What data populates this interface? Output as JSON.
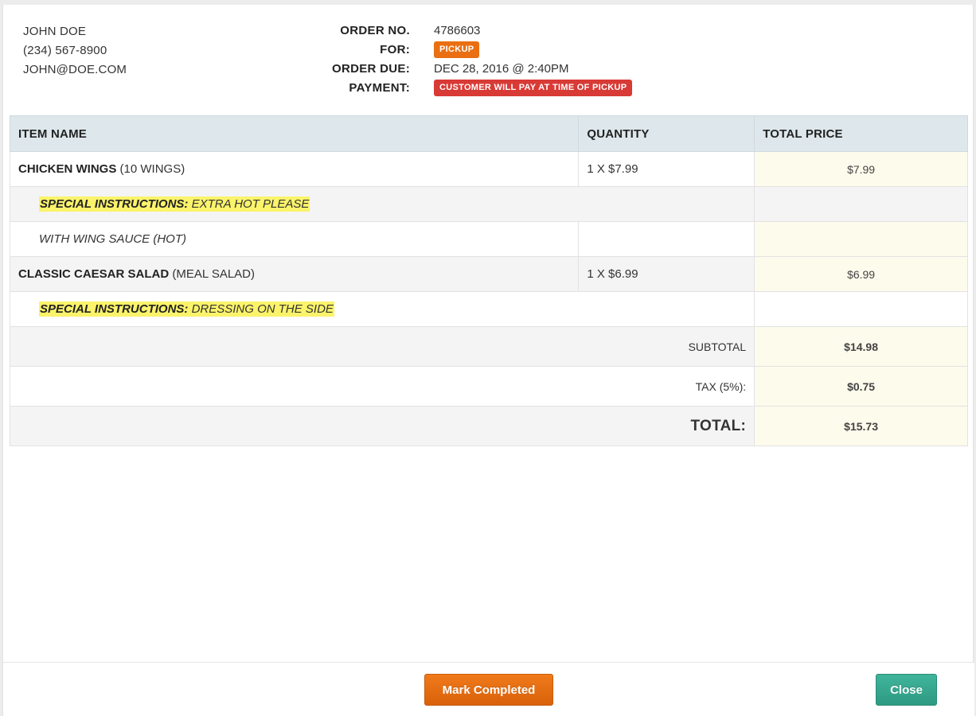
{
  "customer": {
    "name": "JOHN DOE",
    "phone": "(234) 567-8900",
    "email": "JOHN@DOE.COM"
  },
  "order": {
    "number_label": "ORDER NO.",
    "number": "4786603",
    "for_label": "FOR:",
    "for_value": "PICKUP",
    "due_label": "ORDER DUE:",
    "due_value": "DEC 28, 2016 @ 2:40PM",
    "payment_label": "PAYMENT:",
    "payment_value": "CUSTOMER WILL PAY AT TIME OF PICKUP"
  },
  "table": {
    "headers": [
      "ITEM NAME",
      "QUANTITY",
      "TOTAL PRICE"
    ],
    "items": [
      {
        "name": "CHICKEN WINGS",
        "variant": "(10 WINGS)",
        "quantity": "1 X $7.99",
        "price": "$7.99",
        "instructions_label": "SPECIAL INSTRUCTIONS:",
        "instructions": "EXTRA HOT PLEASE",
        "option": "WITH WING SAUCE (HOT)"
      },
      {
        "name": "CLASSIC CAESAR SALAD",
        "variant": "(MEAL SALAD)",
        "quantity": "1 X $6.99",
        "price": "$6.99",
        "instructions_label": "SPECIAL INSTRUCTIONS:",
        "instructions": "DRESSING ON THE SIDE"
      }
    ],
    "subtotal_label": "SUBTOTAL",
    "subtotal": "$14.98",
    "tax_label": "TAX (5%):",
    "tax": "$0.75",
    "total_label": "TOTAL:",
    "total": "$15.73"
  },
  "footer": {
    "mark_completed_label": "Mark Completed",
    "close_label": "Close"
  },
  "colors": {
    "pickup_badge": "#ea6f12",
    "payment_badge": "#d83a36",
    "mark_completed": "#e36a12",
    "close": "#36a78d",
    "instructions_highlight": "#fbf36a"
  }
}
